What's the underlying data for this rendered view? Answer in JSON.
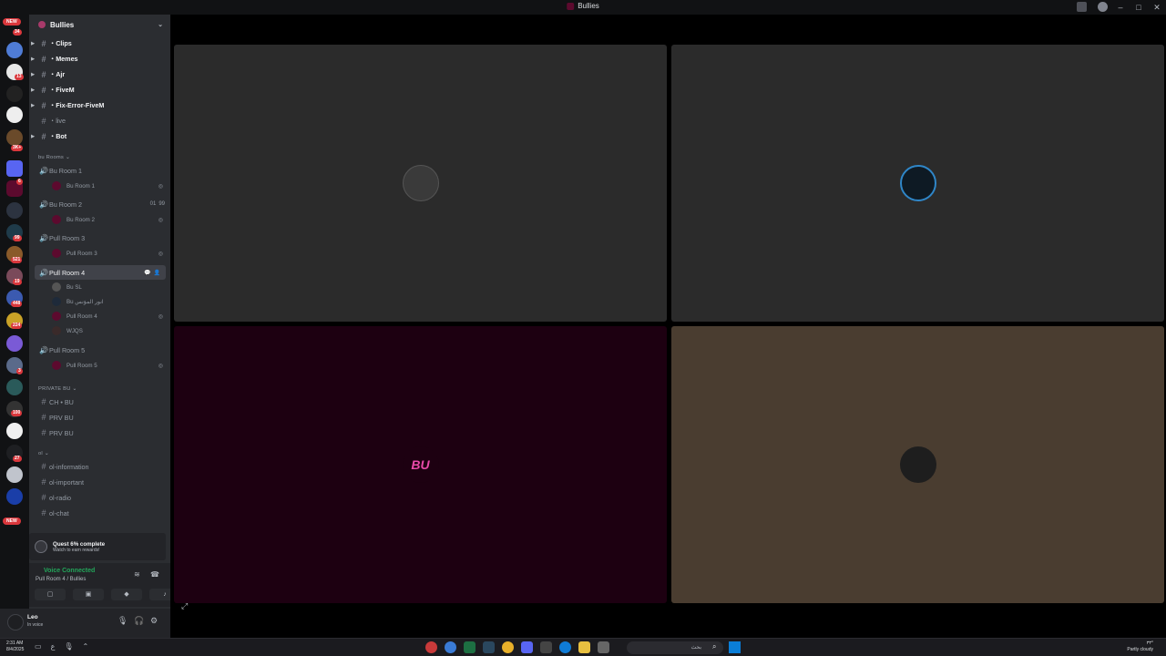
{
  "window": {
    "title": "Bullies"
  },
  "rail": {
    "new_top": "NEW",
    "new_bottom": "NEW",
    "badges": [
      "34",
      "13",
      "3K+",
      "6",
      "99",
      "521",
      "19",
      "448",
      "224",
      "3",
      "100",
      "27"
    ]
  },
  "server": {
    "name": "Bullies"
  },
  "text_channels": [
    {
      "label": "・Clips"
    },
    {
      "label": "・Memes"
    },
    {
      "label": "・Ajr"
    },
    {
      "label": "・FiveM"
    },
    {
      "label": "・Fix-Error-FiveM"
    },
    {
      "label": "・live"
    },
    {
      "label": "・Bot"
    }
  ],
  "categories": {
    "bu_rooms": "bu Rooms",
    "private_bu": "PRIVATE BU",
    "ol": "ol"
  },
  "voice_channels": [
    {
      "label": "Bu Room 1",
      "members": [
        "Bu Room 1"
      ]
    },
    {
      "label": "Bu Room 2",
      "counts": [
        "01",
        "99"
      ],
      "members": [
        "Bu Room 2"
      ]
    },
    {
      "label": "Pull Room 3",
      "members": [
        "Pull Room 3"
      ]
    },
    {
      "label": "Pull Room 4",
      "members": [
        "Bu SL",
        "Bu انور المؤنس",
        "Pull Room 4",
        "WJQS"
      ]
    },
    {
      "label": "Pull Room 5",
      "members": [
        "Pull Room 5"
      ]
    }
  ],
  "private_channels": [
    {
      "label": "CH • BU"
    },
    {
      "label": "PRV BU"
    },
    {
      "label": "PRV BU"
    }
  ],
  "ol_channels": [
    {
      "label": "ol-information"
    },
    {
      "label": "ol-important"
    },
    {
      "label": "ol-radio"
    },
    {
      "label": "ol-chat"
    }
  ],
  "quest": {
    "title": "Quest 6% complete",
    "subtitle": "Watch to earn rewards!"
  },
  "voice_status": {
    "status": "Voice Connected",
    "room": "Pull Room 4 / Bullies"
  },
  "user": {
    "name": "Leo",
    "status": "In voice"
  },
  "stage": {
    "tile_colors": [
      "#2b2b2b",
      "#2b2b2b",
      "#1d0011",
      "#4a3d30"
    ],
    "tile3_logo": "BU"
  },
  "taskbar": {
    "time": "2:31 AM",
    "date": "8/4/2025",
    "search_placeholder": "بحث",
    "weather_temp": "٣٣°",
    "weather_desc": "Partly cloudy"
  }
}
